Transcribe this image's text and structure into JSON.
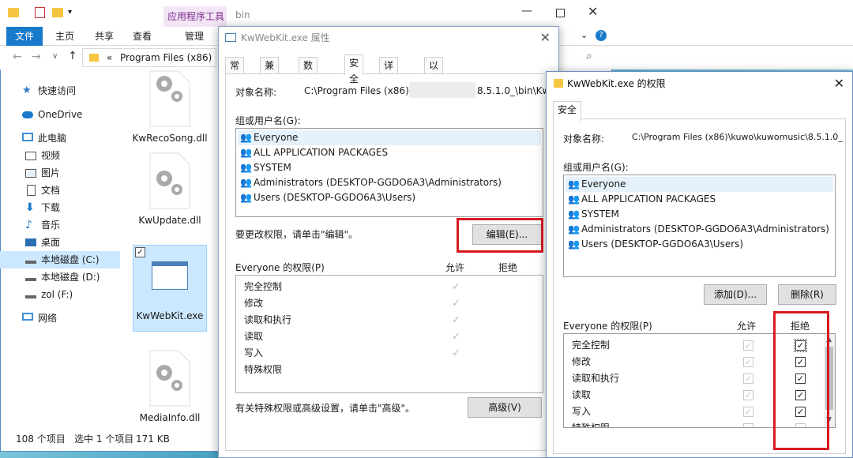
{
  "explorer": {
    "context_tab": "应用程序工具",
    "folder_title": "bin",
    "tabs": {
      "file": "文件",
      "home": "主页",
      "share": "共享",
      "view": "查看",
      "manage": "管理"
    },
    "address": "Program Files (x86)",
    "address_prefix": "«",
    "nav": [
      {
        "label": "快速访问",
        "icon": "star-icon"
      },
      {
        "label": "OneDrive",
        "icon": "cloud-icon"
      },
      {
        "label": "此电脑",
        "icon": "computer-icon"
      },
      {
        "label": "视频",
        "icon": "video-icon"
      },
      {
        "label": "图片",
        "icon": "picture-icon"
      },
      {
        "label": "文档",
        "icon": "document-icon"
      },
      {
        "label": "下载",
        "icon": "download-icon"
      },
      {
        "label": "音乐",
        "icon": "music-icon"
      },
      {
        "label": "桌面",
        "icon": "desktop-icon"
      },
      {
        "label": "本地磁盘 (C:)",
        "icon": "drive-icon"
      },
      {
        "label": "本地磁盘 (D:)",
        "icon": "drive-icon"
      },
      {
        "label": "zol (F:)",
        "icon": "drive-icon"
      },
      {
        "label": "网络",
        "icon": "network-icon"
      }
    ],
    "files": [
      "KwRecoSong.dll",
      "KwUpdate.dll",
      "KwWebKit.exe",
      "MediaInfo.dll"
    ],
    "status": {
      "count": "108 个项目",
      "selected": "选中 1 个项目",
      "size": "171 KB"
    }
  },
  "props": {
    "title": "KwWebKit.exe 属性",
    "tabs": [
      "常规",
      "兼容性",
      "数字签名",
      "安全",
      "详细信息",
      "以前的版本"
    ],
    "object_label": "对象名称:",
    "object_path": "C:\\Program Files (x86)\\k",
    "object_path_tail": "8.5.1.0_\\bin\\Kw",
    "group_label": "组或用户名(G):",
    "users": [
      "Everyone",
      "ALL APPLICATION PACKAGES",
      "SYSTEM",
      "Administrators (DESKTOP-GGDO6A3\\Administrators)",
      "Users (DESKTOP-GGDO6A3\\Users)"
    ],
    "change_hint": "要更改权限，请单击\"编辑\"。",
    "edit_button": "编辑(E)...",
    "perm_header": "Everyone 的权限(P)",
    "allow_header": "允许",
    "deny_header": "拒绝",
    "permissions": [
      "完全控制",
      "修改",
      "读取和执行",
      "读取",
      "写入",
      "特殊权限"
    ],
    "advanced_hint": "有关特殊权限或高级设置，请单击\"高级\"。",
    "advanced_button": "高级(V)"
  },
  "perm": {
    "title": "KwWebKit.exe 的权限",
    "tab": "安全",
    "object_label": "对象名称:",
    "object_path": "C:\\Program Files (x86)\\kuwo\\kuwomusic\\8.5.1.0_",
    "group_label": "组或用户名(G):",
    "users": [
      "Everyone",
      "ALL APPLICATION PACKAGES",
      "SYSTEM",
      "Administrators (DESKTOP-GGDO6A3\\Administrators)",
      "Users (DESKTOP-GGDO6A3\\Users)"
    ],
    "add_button": "添加(D)...",
    "remove_button": "删除(R)",
    "perm_header": "Everyone 的权限(P)",
    "allow_header": "允许",
    "deny_header": "拒绝",
    "permissions": [
      "完全控制",
      "修改",
      "读取和执行",
      "读取",
      "写入",
      "特殊权限"
    ]
  },
  "colors": {
    "accent": "#1979ca",
    "highlight_red": "#d71920",
    "selection": "#cce8ff"
  }
}
